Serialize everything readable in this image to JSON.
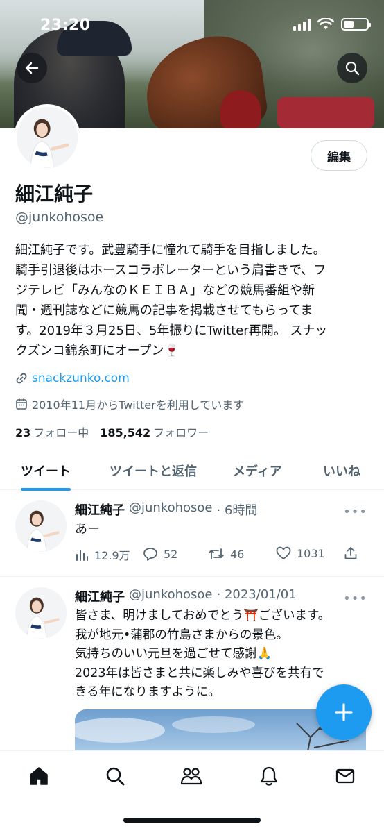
{
  "status_bar": {
    "time": "23:20"
  },
  "profile": {
    "display_name": "細江純子",
    "handle": "@junkohosoe",
    "edit_label": "編集",
    "bio": "細江純子です。武豊騎手に憧れて騎手を目指しました。\n騎手引退後はホースコラボレーターという肩書きで、フ\nジテレビ「みんなのＫＥＩＢＡ」などの競馬番組や新\n聞・週刊誌などに競馬の記事を掲載させてもらってま\nす。2019年３月25日、5年振りにTwitter再開。 スナッ\nクズンコ錦糸町にオープン🍷",
    "link": "snackzunko.com",
    "joined": "2010年11月からTwitterを利用しています",
    "following_count": "23",
    "following_label": "フォロー中",
    "followers_count": "185,542",
    "followers_label": "フォロワー"
  },
  "tabs": [
    {
      "label": "ツイート",
      "active": true
    },
    {
      "label": "ツイートと返信",
      "active": false
    },
    {
      "label": "メディア",
      "active": false
    },
    {
      "label": "いいね",
      "active": false
    }
  ],
  "tweets": [
    {
      "name": "細江純子",
      "handle": "@junkohosoe",
      "time": "· 6時間",
      "text": "あー",
      "views": "12.9万",
      "replies": "52",
      "retweets": "46",
      "likes": "1031"
    },
    {
      "name": "細江純子",
      "handle": "@junkohosoe",
      "time": "· 2023/01/01",
      "text": "皆さま、明けましておめでとう⛩️ございます。\n我が地元•蒲郡の竹島さまからの景色。\n気持ちのいい元旦を過ごせて感謝🙏\n2023年は皆さまと共に楽しみや喜びを共有で\nきる年になりますように。"
    }
  ],
  "more_glyph": "•••",
  "colors": {
    "accent": "#1d9bf0",
    "text": "#0f1419",
    "muted": "#536471"
  },
  "icons": [
    "back-arrow-icon",
    "search-icon",
    "link-icon",
    "calendar-icon",
    "views-icon",
    "reply-icon",
    "retweet-icon",
    "like-icon",
    "share-icon",
    "compose-icon",
    "home-icon",
    "explore-icon",
    "communities-icon",
    "notifications-icon",
    "messages-icon"
  ]
}
